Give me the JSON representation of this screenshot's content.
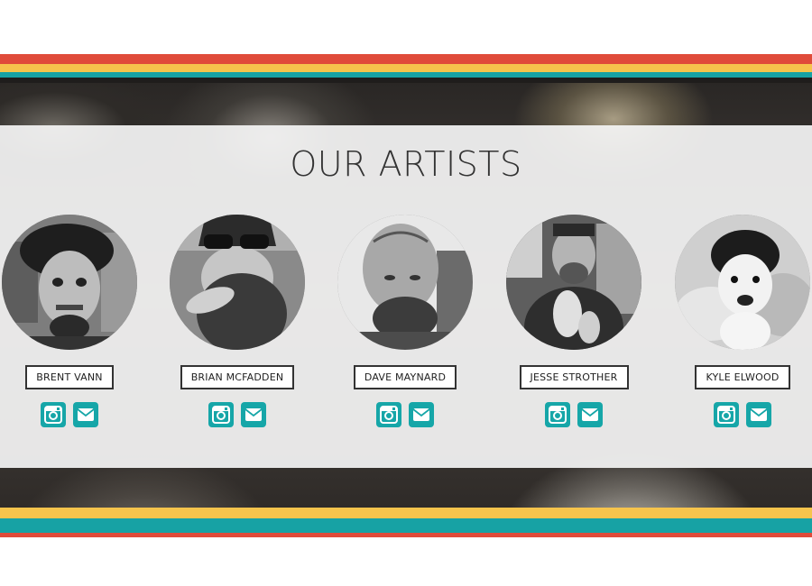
{
  "section": {
    "title": "OUR ARTISTS"
  },
  "colors": {
    "red": "#e04b3a",
    "yellow": "#f6c44c",
    "teal": "#17a2a4",
    "accent_icon": "#16a6a8"
  },
  "artists": [
    {
      "name": "BRENT VANN",
      "icons": [
        "instagram-icon",
        "mail-icon"
      ]
    },
    {
      "name": "BRIAN MCFADDEN",
      "icons": [
        "instagram-icon",
        "mail-icon"
      ]
    },
    {
      "name": "DAVE MAYNARD",
      "icons": [
        "instagram-icon",
        "mail-icon"
      ]
    },
    {
      "name": "JESSE STROTHER",
      "icons": [
        "instagram-icon",
        "mail-icon"
      ]
    },
    {
      "name": "KYLE ELWOOD",
      "icons": [
        "instagram-icon",
        "mail-icon"
      ]
    }
  ]
}
